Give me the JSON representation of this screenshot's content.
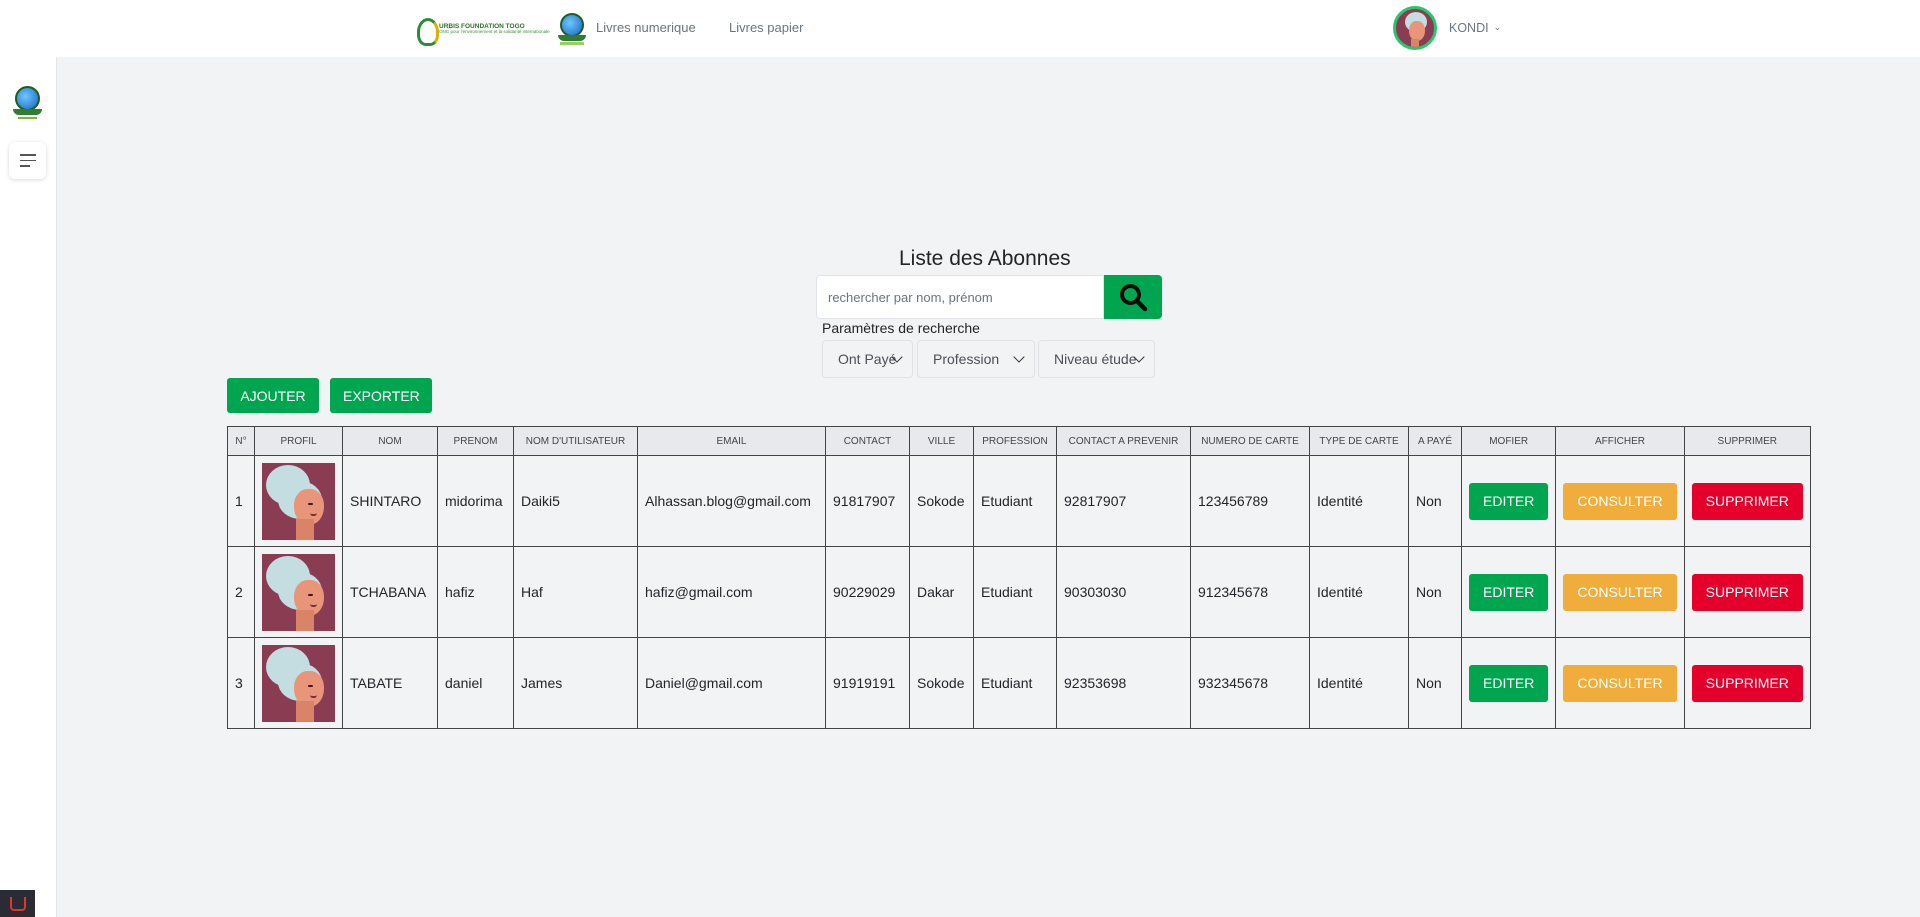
{
  "header": {
    "logo_text_line1": "URBIS FOUNDATION TOGO",
    "logo_text_line2": "ONG pour l'environnement et la solidarité internationale",
    "nav": [
      "Livres numerique",
      "Livres papier"
    ],
    "user_name": "KONDI"
  },
  "page": {
    "title": "Liste des Abonnes",
    "search_placeholder": "rechercher par nom, prénom",
    "params_label": "Paramètres de recherche",
    "filters": [
      "Ont Payé",
      "Profession",
      "Niveau étude"
    ],
    "add_label": "AJOUTER",
    "export_label": "EXPORTER"
  },
  "table": {
    "columns": [
      "N°",
      "PROFIL",
      "NOM",
      "PRENOM",
      "NOM D'UTILISATEUR",
      "EMAIL",
      "CONTACT",
      "VILLE",
      "PROFESSION",
      "CONTACT A PREVENIR",
      "NUMERO DE CARTE",
      "TYPE DE CARTE",
      "A PAYÉ",
      "MOFIER",
      "AFFICHER",
      "SUPPRIMER"
    ],
    "rows": [
      {
        "n": "1",
        "nom": "SHINTARO",
        "prenom": "midorima",
        "username": "Daiki5",
        "email": "Alhassan.blog@gmail.com",
        "contact": "91817907",
        "ville": "Sokode",
        "profession": "Etudiant",
        "contact_prevenir": "92817907",
        "numero_carte": "123456789",
        "type_carte": "Identité",
        "a_paye": "Non"
      },
      {
        "n": "2",
        "nom": "TCHABANA",
        "prenom": "hafiz",
        "username": "Haf",
        "email": "hafiz@gmail.com",
        "contact": "90229029",
        "ville": "Dakar",
        "profession": "Etudiant",
        "contact_prevenir": "90303030",
        "numero_carte": "912345678",
        "type_carte": "Identité",
        "a_paye": "Non"
      },
      {
        "n": "3",
        "nom": "TABATE",
        "prenom": "daniel",
        "username": "James",
        "email": "Daniel@gmail.com",
        "contact": "91919191",
        "ville": "Sokode",
        "profession": "Etudiant",
        "contact_prevenir": "92353698",
        "numero_carte": "932345678",
        "type_carte": "Identité",
        "a_paye": "Non"
      }
    ],
    "actions": {
      "edit": "EDITER",
      "view": "CONSULTER",
      "delete": "SUPPRIMER"
    }
  },
  "colors": {
    "primary_green": "#00a550",
    "warning_orange": "#f0ad3c",
    "danger_red": "#e4002b",
    "background": "#f2f3f5"
  },
  "icons": [
    "search-icon",
    "menu-toggle-icon",
    "chevron-down-icon",
    "laravel-icon"
  ]
}
